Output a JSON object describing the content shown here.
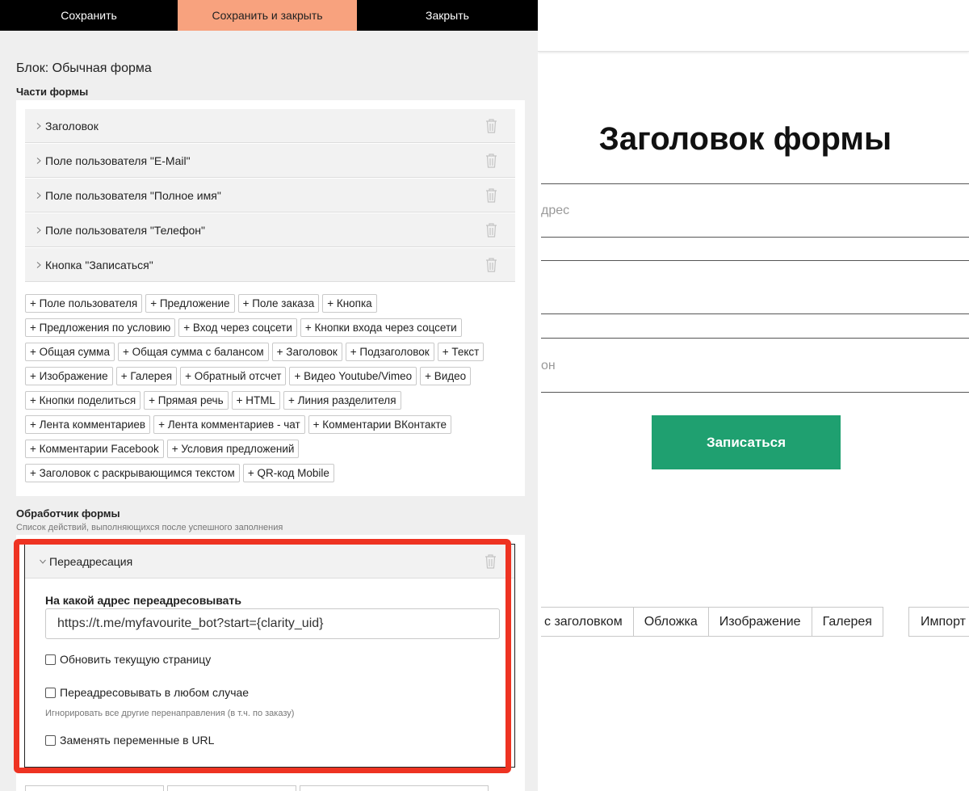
{
  "toolbar": {
    "save_label": "Сохранить",
    "save_close_label": "Сохранить и закрыть",
    "close_label": "Закрыть"
  },
  "editor": {
    "block_title": "Блок: Обычная форма",
    "parts_label": "Части формы",
    "parts": [
      {
        "label": "Заголовок"
      },
      {
        "label": "Поле пользователя \"E-Mail\""
      },
      {
        "label": "Поле пользователя \"Полное имя\""
      },
      {
        "label": "Поле пользователя \"Телефон\""
      },
      {
        "label": "Кнопка \"Записаться\""
      }
    ],
    "add_rows": [
      [
        "+ Поле пользователя",
        "+ Предложение",
        "+ Поле заказа",
        "+ Кнопка"
      ],
      [
        "+ Предложения по условию",
        "+ Вход через соцсети",
        "+ Кнопки входа через соцсети"
      ],
      [
        "+ Общая сумма",
        "+ Общая сумма с балансом",
        "+ Заголовок",
        "+ Подзаголовок",
        "+ Текст"
      ],
      [
        "+ Изображение",
        "+ Галерея",
        "+ Обратный отсчет",
        "+ Видео Youtube/Vimeo",
        "+ Видео"
      ],
      [
        "+ Кнопки поделиться",
        "+ Прямая речь",
        "+ HTML",
        "+ Линия разделителя"
      ],
      [
        "+ Лента комментариев",
        "+ Лента комментариев - чат",
        "+ Комментарии ВКонтакте"
      ],
      [
        "+ Комментарии Facebook",
        "+ Условия предложений"
      ],
      [
        "+ Заголовок с раскрывающимся текстом",
        "+ QR-код Mobile"
      ]
    ],
    "handler_label": "Обработчик формы",
    "handler_sub": "Список действий, выполняющихся после успешного заполнения",
    "handler": {
      "title": "Переадресация",
      "url_label": "На какой адрес переадресовывать",
      "url_value": "https://t.me/myfavourite_bot?start={clarity_uid}",
      "checkbox_refresh": "Обновить текущую страницу",
      "checkbox_always": "Переадресовывать в любом случае",
      "checkbox_always_hint": "Игнорировать все другие перенаправления (в т.ч. по заказу)",
      "checkbox_vars": "Заменять переменные в URL"
    },
    "highlight_color": "#ee3322"
  },
  "preview": {
    "form_title": "Заголовок формы",
    "field_email_partial": "дрес",
    "field_phone_partial": "он",
    "submit_label": "Записаться",
    "submit_color": "#1fa070",
    "tabs": [
      "с заголовком",
      "Обложка",
      "Изображение",
      "Галерея"
    ],
    "import_label": "Импорт"
  }
}
